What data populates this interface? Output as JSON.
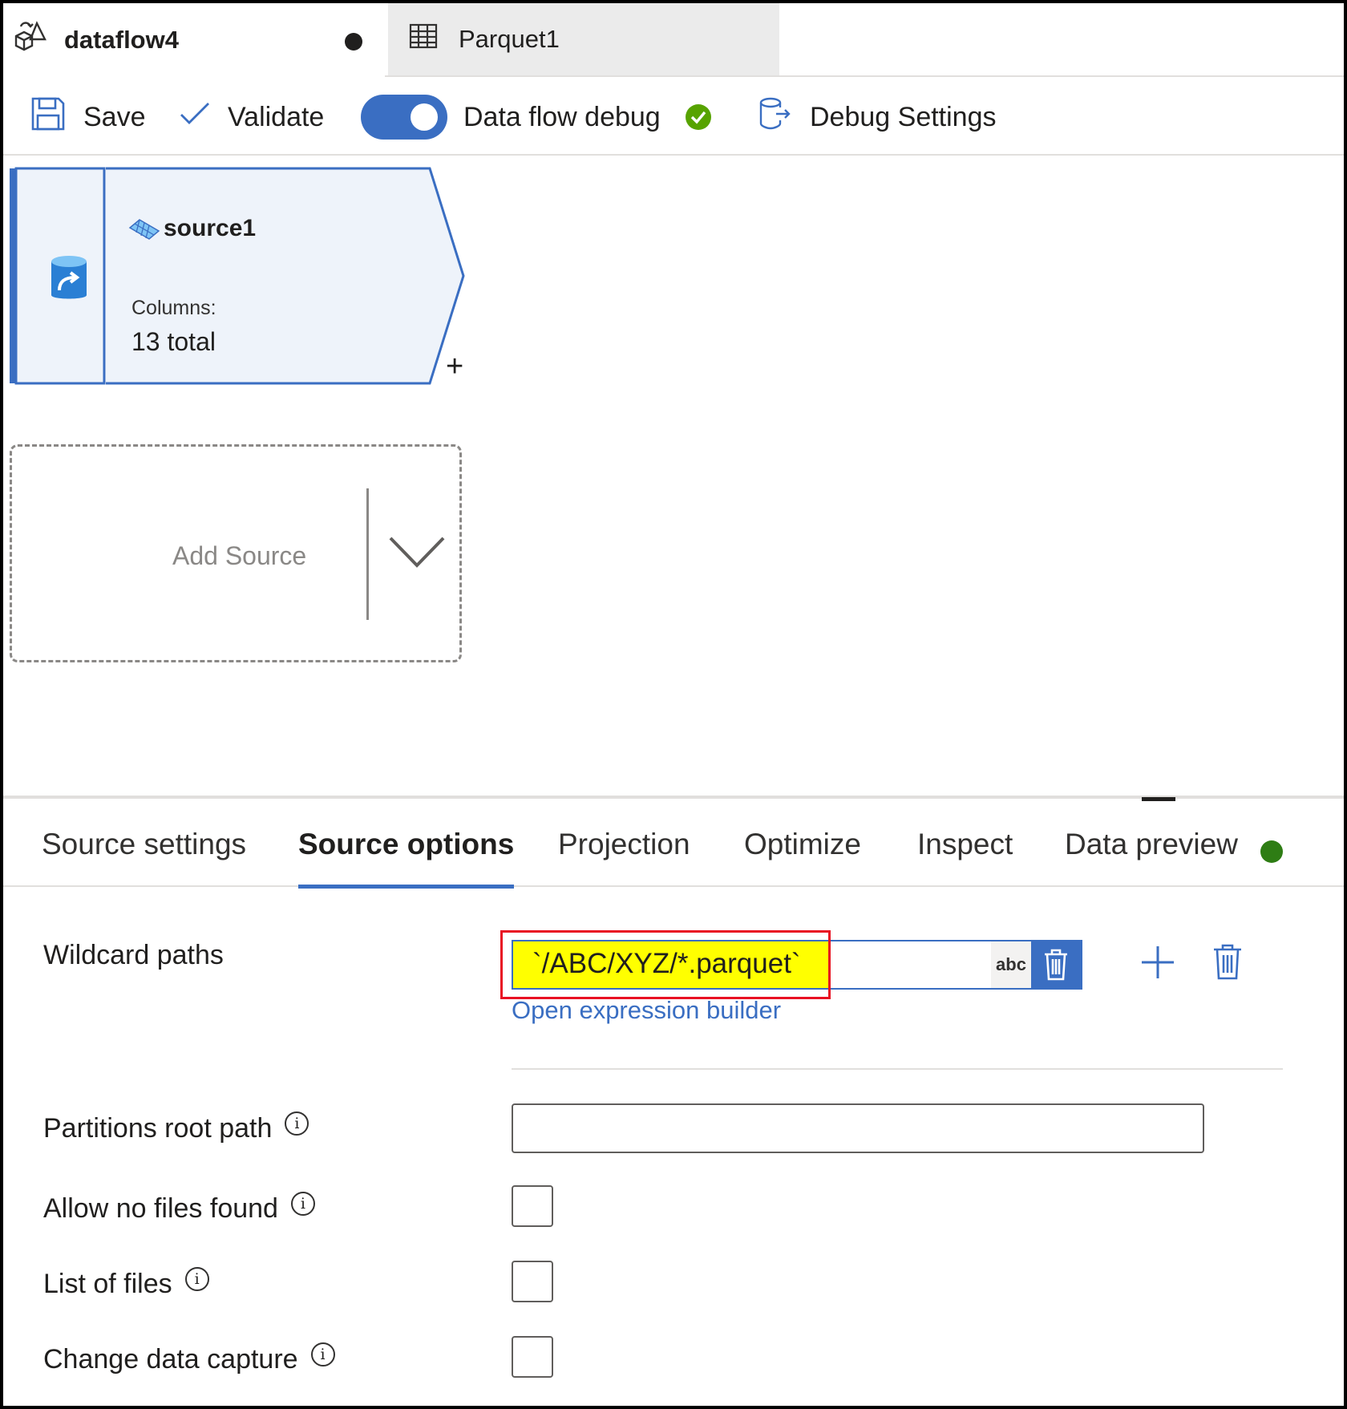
{
  "tabs": {
    "dataflow_label": "dataflow4",
    "parquet_label": "Parquet1"
  },
  "toolbar": {
    "save_label": "Save",
    "validate_label": "Validate",
    "debug_label": "Data flow debug",
    "debug_enabled": true,
    "debug_settings_label": "Debug Settings"
  },
  "canvas": {
    "source_node": {
      "title": "source1",
      "columns_label": "Columns:",
      "columns_value": "13 total",
      "add_symbol": "+"
    },
    "add_source_label": "Add Source"
  },
  "bottom_tabs": {
    "items": [
      "Source settings",
      "Source options",
      "Projection",
      "Optimize",
      "Inspect",
      "Data preview"
    ],
    "active": "Source options"
  },
  "form": {
    "wildcard_label": "Wildcard paths",
    "wildcard_value": "`/ABC/XYZ/*.parquet`",
    "abc_badge": "abc",
    "expression_link": "Open expression builder",
    "partitions_label": "Partitions root path",
    "partitions_value": "",
    "allow_label": "Allow no files found",
    "list_label": "List of files",
    "cdc_label": "Change data capture",
    "info_glyph": "i"
  },
  "colors": {
    "accent": "#3a6ec2",
    "highlight": "#ffff00",
    "highlight_border": "#e81123",
    "status_green": "#2e7d14"
  }
}
